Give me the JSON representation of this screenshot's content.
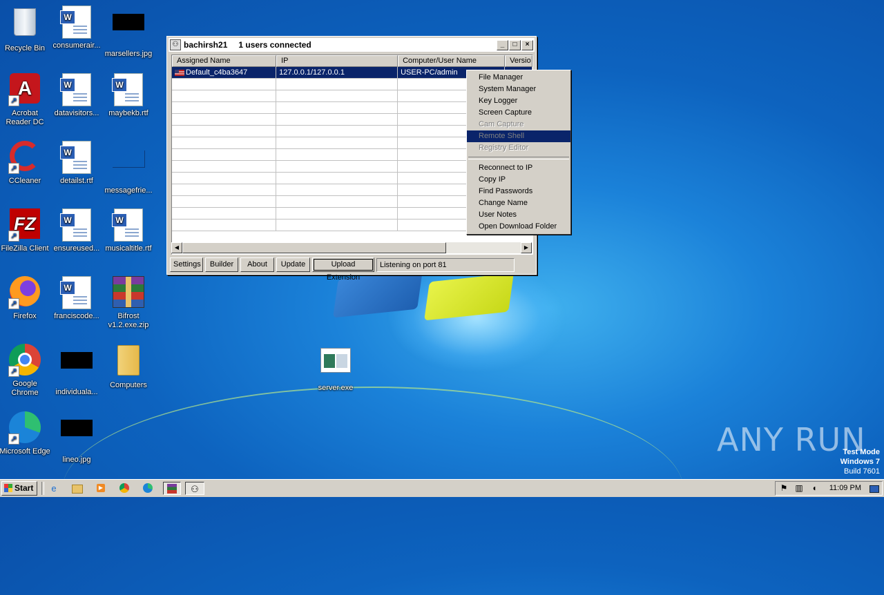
{
  "desktop": {
    "icons": [
      {
        "label": "Recycle Bin"
      },
      {
        "label": "consumerair..."
      },
      {
        "label": "marsellers.jpg"
      },
      {
        "label": "Acrobat Reader DC"
      },
      {
        "label": "datavisitors..."
      },
      {
        "label": "maybekb.rtf"
      },
      {
        "label": "CCleaner"
      },
      {
        "label": "detailst.rtf"
      },
      {
        "label": "messagefrie..."
      },
      {
        "label": "FileZilla Client"
      },
      {
        "label": "ensureused..."
      },
      {
        "label": "musicaltitle.rtf"
      },
      {
        "label": "Firefox"
      },
      {
        "label": "franciscode..."
      },
      {
        "label": "Bifrost v1.2.exe.zip"
      },
      {
        "label": "Google Chrome"
      },
      {
        "label": "individuala..."
      },
      {
        "label": "Computers"
      },
      {
        "label": "Microsoft Edge"
      },
      {
        "label": "lineo.jpg"
      },
      {
        "label": "server.exe"
      }
    ]
  },
  "window": {
    "title": "bachirsh21",
    "subtitle": "1 users connected",
    "columns": [
      "Assigned Name",
      "IP",
      "Computer/User Name",
      "Versio"
    ],
    "rows": [
      {
        "name": "Default_c4ba3647",
        "ip": "127.0.0.1/127.0.0.1",
        "user": "USER-PC/admin",
        "version": ""
      }
    ],
    "buttons": {
      "settings": "Settings",
      "builder": "Builder",
      "about": "About",
      "update": "Update",
      "upload": "Upload Extension"
    },
    "status": "Listening on port 81"
  },
  "context_menu": {
    "items": [
      {
        "label": "File Manager",
        "enabled": true
      },
      {
        "label": "System Manager",
        "enabled": true
      },
      {
        "label": "Key Logger",
        "enabled": true
      },
      {
        "label": "Screen Capture",
        "enabled": true
      },
      {
        "label": "Cam Capture",
        "enabled": false
      },
      {
        "label": "Remote Shell",
        "enabled": false,
        "highlighted": true
      },
      {
        "label": "Registry Editor",
        "enabled": false
      },
      {
        "label": "Reconnect to IP",
        "enabled": true
      },
      {
        "label": "Copy IP",
        "enabled": true
      },
      {
        "label": "Find Passwords",
        "enabled": true
      },
      {
        "label": "Change Name",
        "enabled": true
      },
      {
        "label": "User Notes",
        "enabled": true
      },
      {
        "label": "Open Download Folder",
        "enabled": true
      }
    ]
  },
  "watermark": {
    "brand": "ANY RUN",
    "mode": "Test Mode",
    "os": "Windows 7",
    "build": "Build 7601"
  },
  "taskbar": {
    "start_label": "Start",
    "clock": "11:09 PM",
    "pinned": [
      "ie-icon",
      "explorer-icon",
      "media-player-icon",
      "chrome-icon",
      "edge-icon",
      "winrar-icon",
      "rat-app-icon"
    ]
  },
  "colors": {
    "selection": "#0a246a",
    "window_face": "#d4d0c8"
  }
}
